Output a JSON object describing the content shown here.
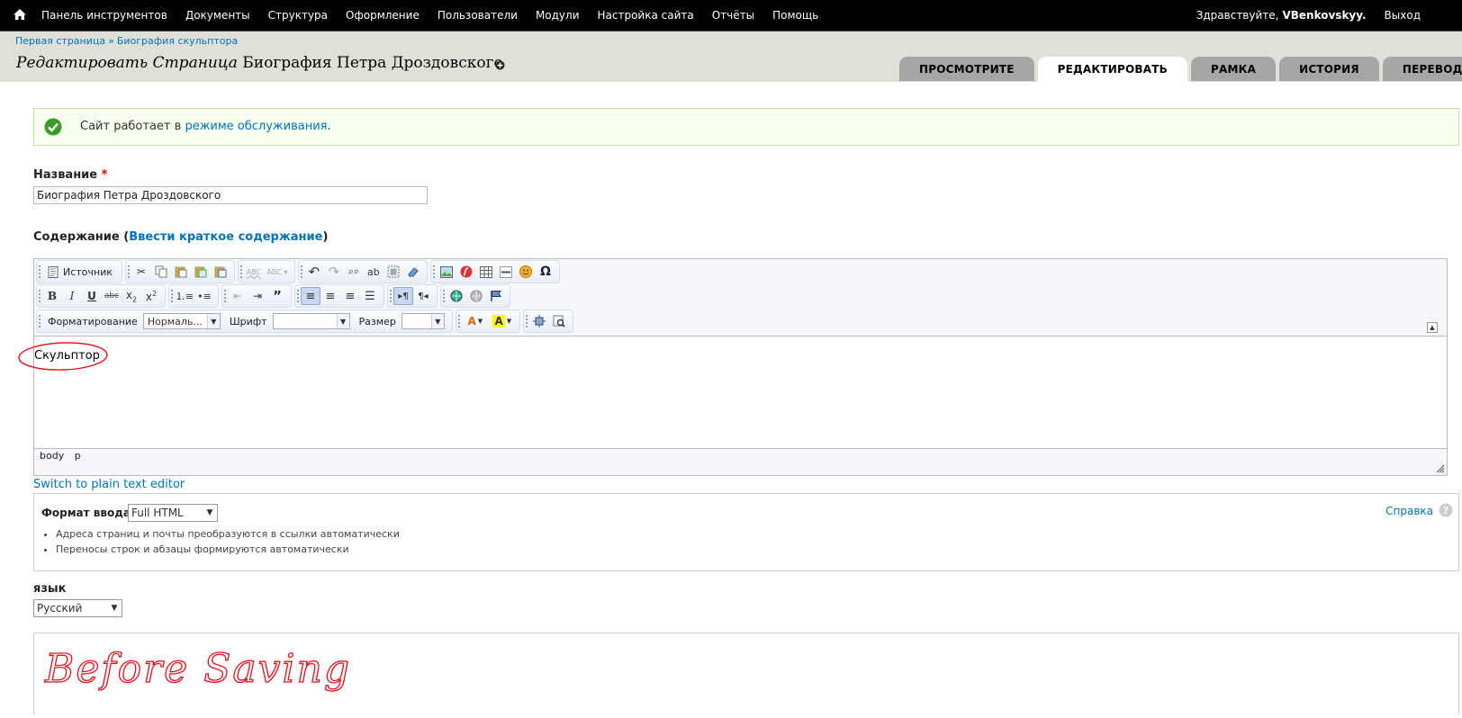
{
  "toolbar": {
    "menu": [
      "Панель инструментов",
      "Документы",
      "Структура",
      "Оформление",
      "Пользователи",
      "Модули",
      "Настройка сайта",
      "Отчёты",
      "Помощь"
    ],
    "greeting": "Здравствуйте,",
    "username": "VBenkovskyy.",
    "logout": "Выход"
  },
  "breadcrumb": [
    "Первая страница",
    "Биография скульптора"
  ],
  "breadcrumb_sep": "»",
  "page": {
    "title_prefix": "Редактировать Страница",
    "title_name": "Биография Петра Дроздовского"
  },
  "tabs": [
    "Просмотрите",
    "Редактировать",
    "Рамка",
    "История",
    "Переводить"
  ],
  "active_tab": 1,
  "message": {
    "text_before": "Сайт работает в",
    "link": "режиме обслуживания",
    "text_after": "."
  },
  "form": {
    "title_label": "Название",
    "required_mark": "*",
    "title_value": "Биография Петра Дроздовского",
    "body_label": "Содержание",
    "summary_link": "Ввести краткое содержание",
    "paren_open": "(",
    "paren_close": ")"
  },
  "editor": {
    "source_label": "Источник",
    "format_label": "Форматирование",
    "format_value": "Нормаль...",
    "font_label": "Шрифт",
    "font_value": "",
    "size_label": "Размер",
    "size_value": "",
    "content": "Скульптор",
    "path": [
      "body",
      "p"
    ]
  },
  "plain_text_link": "Switch to plain text editor",
  "input_format": {
    "label": "Формат ввода",
    "value": "Full HTML",
    "help": "Справка",
    "tips": [
      "Адреса страниц и почты преобразуются в ссылки автоматически",
      "Переносы строк и абзацы формируются автоматически"
    ]
  },
  "language": {
    "label": "язык",
    "value": "Русский"
  },
  "annotation": {
    "text": "Before Saving",
    "color": "#e8101a"
  },
  "colors": {
    "toolbar_bg": "#000000",
    "header_bg": "#e0e0d8",
    "link": "#0074bd",
    "tab_inactive": "#a6a6a6",
    "ok_green": "#3b9c2a"
  }
}
